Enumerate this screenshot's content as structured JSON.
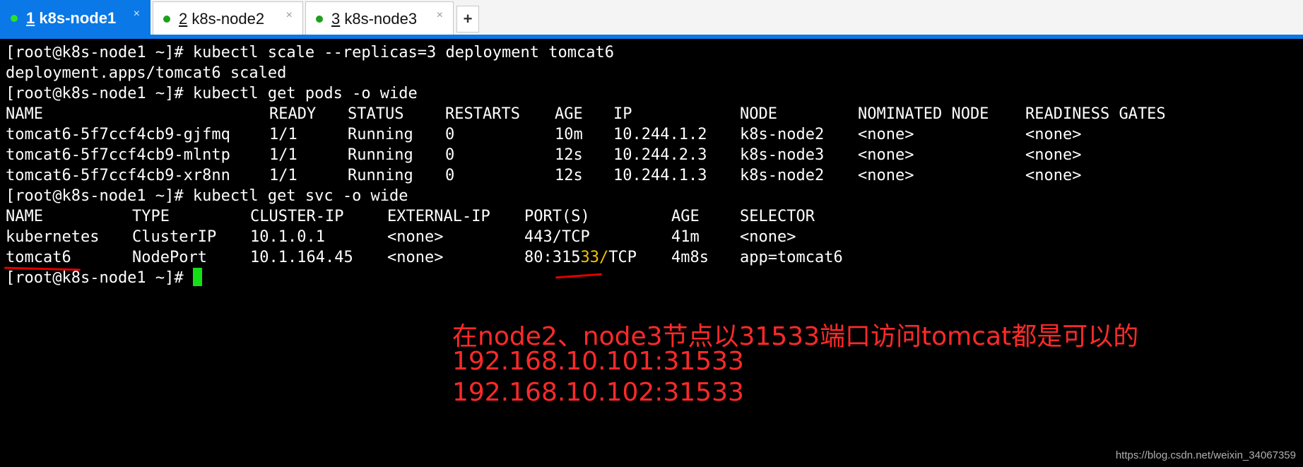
{
  "tabs": [
    {
      "number": "1",
      "title": " k8s-node1",
      "close": "×",
      "active": true
    },
    {
      "number": "2",
      "title": " k8s-node2",
      "close": "×",
      "active": false
    },
    {
      "number": "3",
      "title": " k8s-node3",
      "close": "×",
      "active": false
    }
  ],
  "new_tab_label": "+",
  "terminal": {
    "line1": "[root@k8s-node1 ~]# kubectl scale --replicas=3 deployment tomcat6",
    "line2": "deployment.apps/tomcat6 scaled",
    "line3": "[root@k8s-node1 ~]# kubectl get pods -o wide",
    "pods": {
      "headers": [
        "NAME",
        "READY",
        "STATUS",
        "RESTARTS",
        "AGE",
        "IP",
        "NODE",
        "NOMINATED NODE",
        "READINESS GATES"
      ],
      "rows": [
        [
          "tomcat6-5f7ccf4cb9-gjfmq",
          "1/1",
          "Running",
          "0",
          "10m",
          "10.244.1.2",
          "k8s-node2",
          "<none>",
          "<none>"
        ],
        [
          "tomcat6-5f7ccf4cb9-mlntp",
          "1/1",
          "Running",
          "0",
          "12s",
          "10.244.2.3",
          "k8s-node3",
          "<none>",
          "<none>"
        ],
        [
          "tomcat6-5f7ccf4cb9-xr8nn",
          "1/1",
          "Running",
          "0",
          "12s",
          "10.244.1.3",
          "k8s-node2",
          "<none>",
          "<none>"
        ]
      ]
    },
    "line7": "[root@k8s-node1 ~]# kubectl get svc -o wide",
    "svc": {
      "headers": [
        "NAME",
        "TYPE",
        "CLUSTER-IP",
        "EXTERNAL-IP",
        "PORT(S)",
        "AGE",
        "SELECTOR"
      ],
      "rows": [
        [
          "kubernetes",
          "ClusterIP",
          "10.1.0.1",
          "<none>",
          "443/TCP",
          "41m",
          "<none>"
        ],
        [
          "tomcat6",
          "NodePort",
          "10.1.164.45",
          "<none>",
          "80:31533/TCP",
          "4m8s",
          "app=tomcat6"
        ]
      ],
      "port_parts": {
        "a": "80:315",
        "b": "33/",
        "c": "TCP"
      }
    },
    "prompt": "[root@k8s-node1 ~]# "
  },
  "annotation": {
    "line1": "在node2、node3节点以31533端口访问tomcat都是可以的",
    "line2": "192.168.10.101:31533",
    "line3": "192.168.10.102:31533"
  },
  "watermark": "https://blog.csdn.net/weixin_34067359",
  "colors": {
    "terminal_bg": "#000000",
    "terminal_fg": "#ffffff",
    "accent_tab": "#0a78e6",
    "cursor": "#15e015",
    "annotation": "#ff2a2a",
    "highlight": "#f2c200"
  }
}
